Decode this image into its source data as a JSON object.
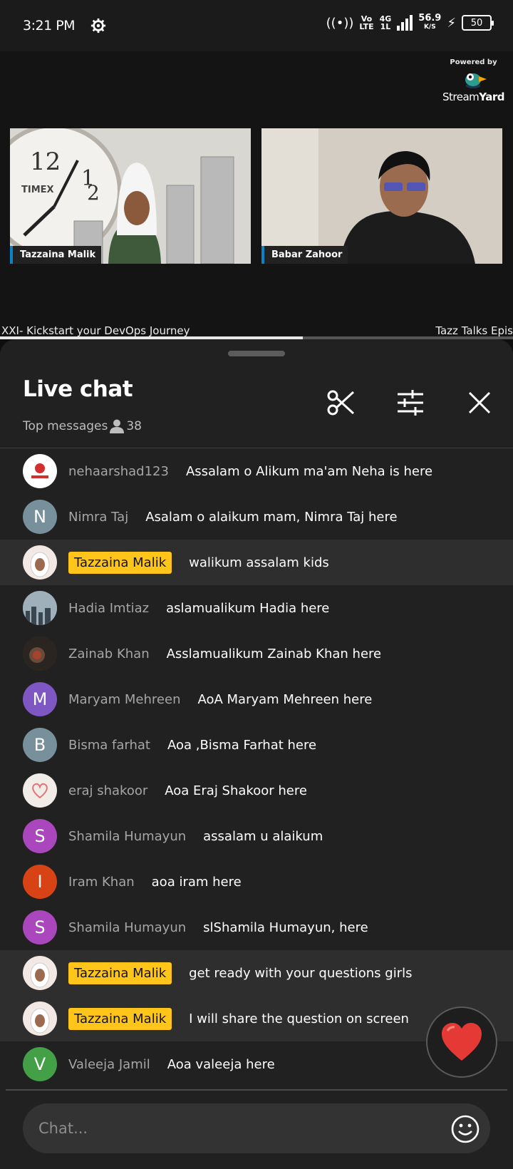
{
  "status": {
    "time": "3:21 PM",
    "network_top": "Vo",
    "network_bottom": "LTE",
    "gen_top": "4G",
    "gen_bottom": "1L",
    "speed_value": "56.9",
    "speed_unit": "K/S",
    "battery": "50"
  },
  "stream": {
    "powered_by": "Powered by",
    "brand_a": "Stream",
    "brand_b": "Yard",
    "participants": [
      {
        "name": "Tazzaina Malik"
      },
      {
        "name": "Babar Zahoor"
      }
    ],
    "ticker_left": "XXI- Kickstart your DevOps Journey",
    "ticker_right": "Tazz Talks Epis",
    "progress": 0.59
  },
  "chat": {
    "title": "Live chat",
    "subtitle": "Top messages",
    "viewer_count": "38",
    "input_placeholder": "Chat...",
    "accent_owner": "#ffc51a",
    "messages": [
      {
        "author": "nehaarshad123",
        "text": "Assalam o Alikum ma'am Neha is here",
        "initial": "",
        "color": "#ffffff",
        "owner": false,
        "icon": "channel-logo"
      },
      {
        "author": "Nimra Taj",
        "text": "Asalam o alaikum mam, Nimra Taj here",
        "initial": "N",
        "color": "#78909c",
        "owner": false
      },
      {
        "author": "Tazzaina Malik",
        "text": "walikum assalam kids",
        "initial": "",
        "color": "#f3e9e4",
        "owner": true,
        "icon": "hijab-avatar"
      },
      {
        "author": "Hadia Imtiaz",
        "text": "aslamualikum Hadia here",
        "initial": "",
        "color": "#8a9aa4",
        "owner": false,
        "icon": "skyline-photo"
      },
      {
        "author": "Zainab Khan",
        "text": "Asslamualikum Zainab Khan here",
        "initial": "",
        "color": "#4a3a32",
        "owner": false,
        "icon": "dark-photo"
      },
      {
        "author": "Maryam Mehreen",
        "text": "AoA Maryam Mehreen here",
        "initial": "M",
        "color": "#7e57c2",
        "owner": false
      },
      {
        "author": "Bisma farhat",
        "text": "Aoa ,Bisma Farhat here",
        "initial": "B",
        "color": "#78909c",
        "owner": false
      },
      {
        "author": "eraj shakoor",
        "text": "Aoa Eraj Shakoor here",
        "initial": "",
        "color": "#f1ece8",
        "owner": false,
        "icon": "heart-sketch"
      },
      {
        "author": "Shamila Humayun",
        "text": "assalam u alaikum",
        "initial": "S",
        "color": "#ab47bc",
        "owner": false
      },
      {
        "author": "Iram Khan",
        "text": "aoa iram here",
        "initial": "I",
        "color": "#d84315",
        "owner": false
      },
      {
        "author": "Shamila Humayun",
        "text": "slShamila Humayun, here",
        "initial": "S",
        "color": "#ab47bc",
        "owner": false
      },
      {
        "author": "Tazzaina Malik",
        "text": "get ready with your questions girls",
        "initial": "",
        "color": "#f3e9e4",
        "owner": true,
        "icon": "hijab-avatar"
      },
      {
        "author": "Tazzaina Malik",
        "text": "I will share the question on screen",
        "initial": "",
        "color": "#f3e9e4",
        "owner": true,
        "icon": "hijab-avatar"
      },
      {
        "author": "Valeeja Jamil",
        "text": "Aoa valeeja here",
        "initial": "V",
        "color": "#43a047",
        "owner": false
      }
    ]
  }
}
